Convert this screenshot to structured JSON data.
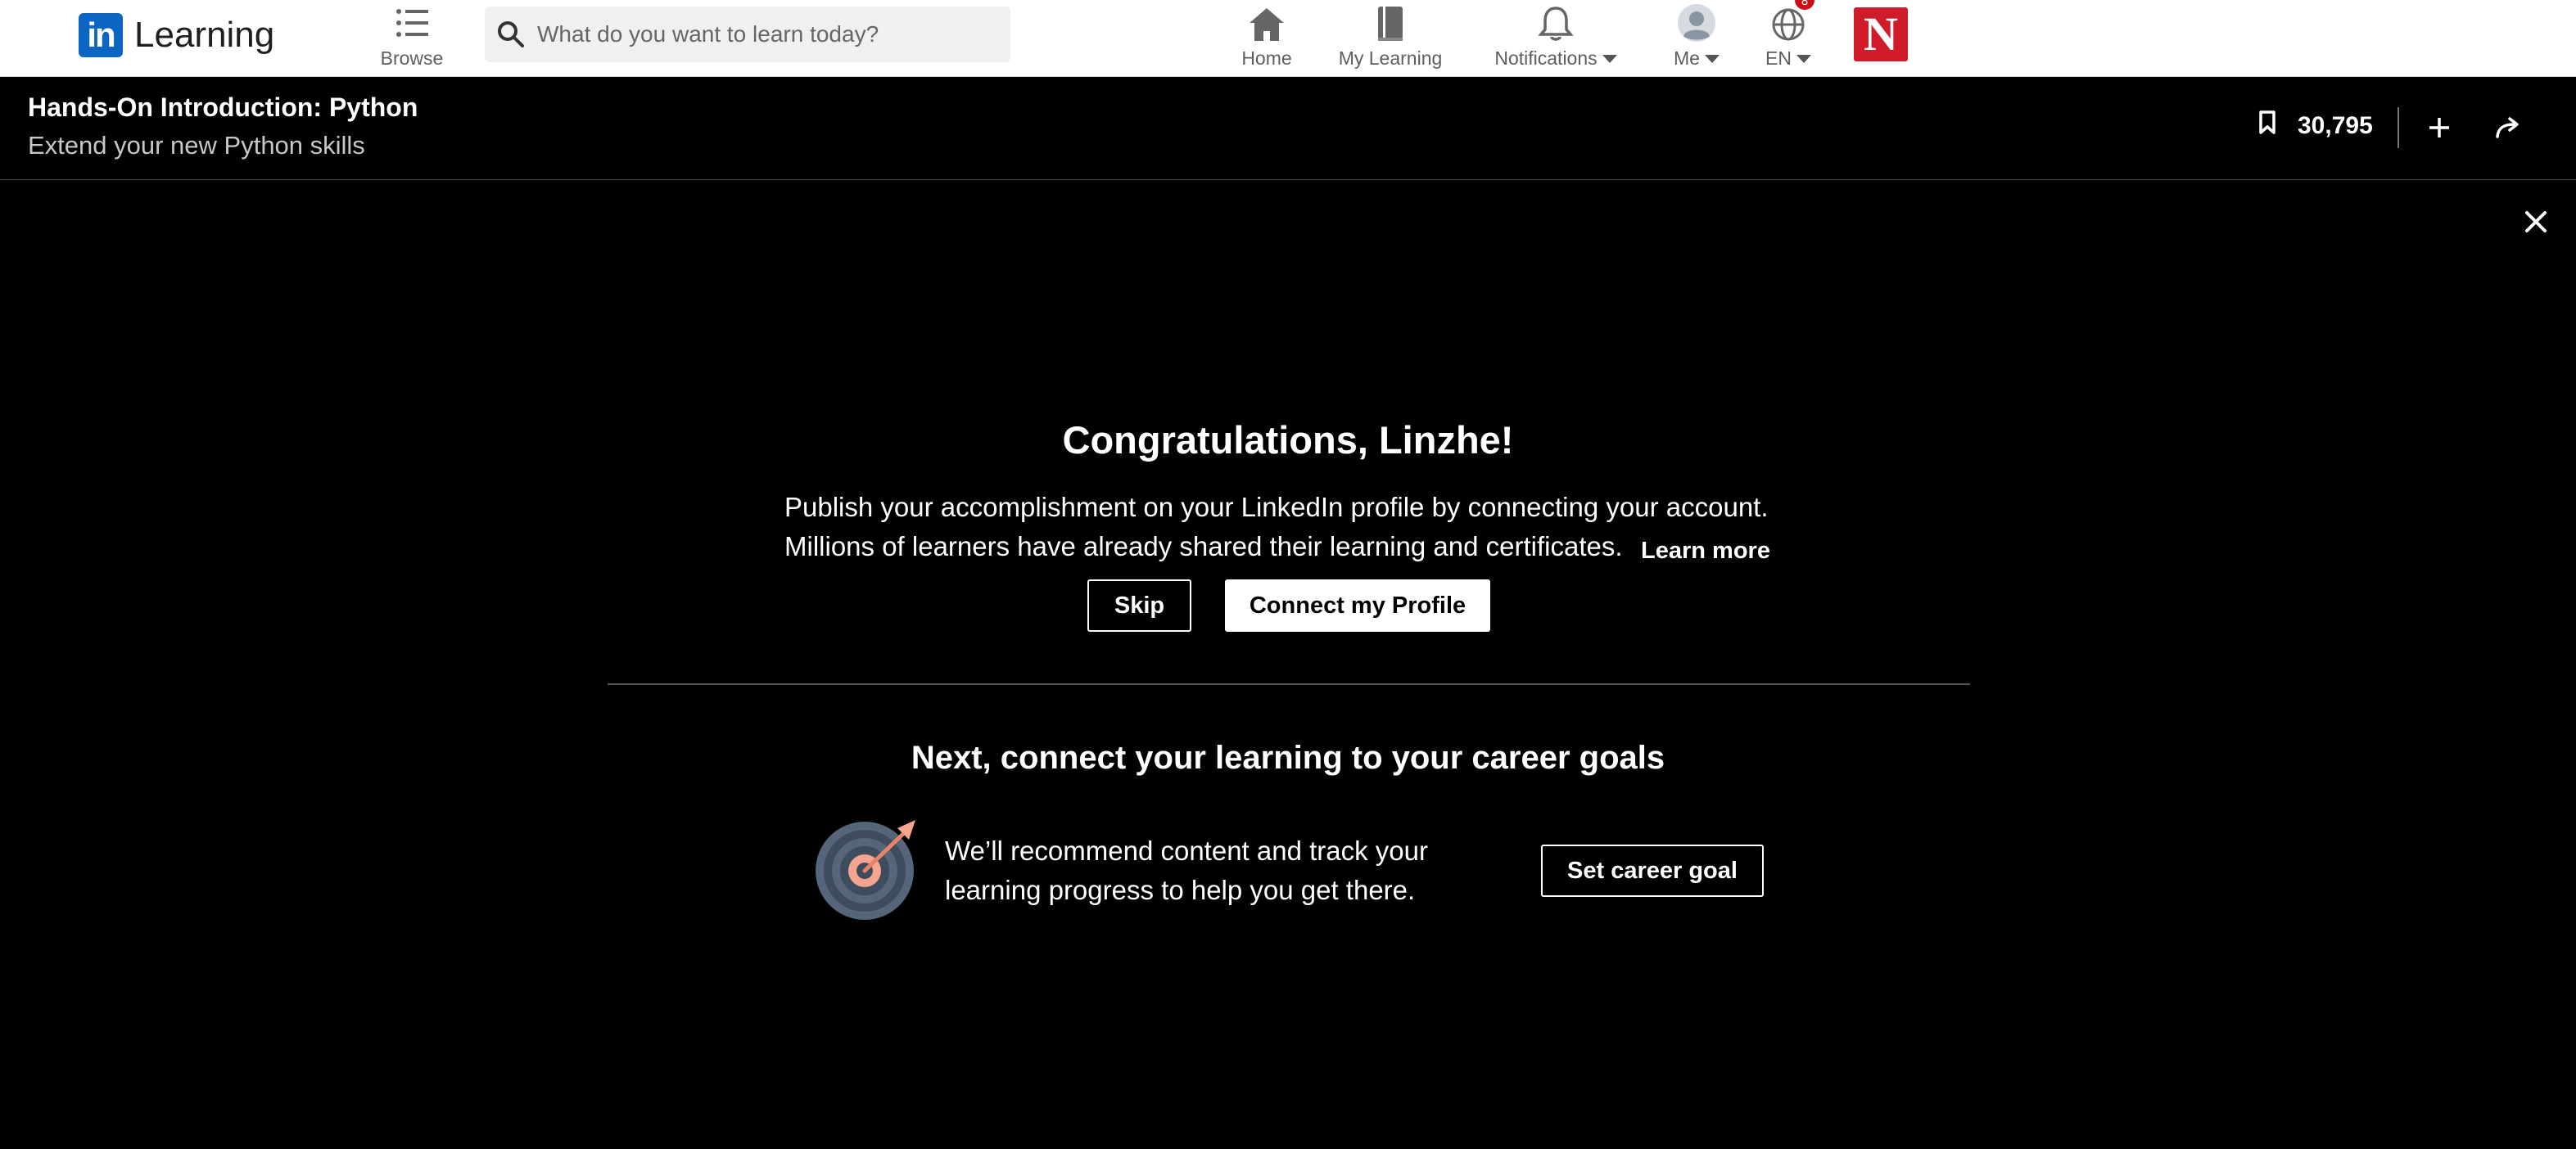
{
  "nav": {
    "logo_mark": "in",
    "logo_text": "Learning",
    "browse_label": "Browse",
    "search_placeholder": "What do you want to learn today?",
    "home_label": "Home",
    "my_learning_label": "My Learning",
    "notifications_label": "Notifications",
    "me_label": "Me",
    "language_label": "EN",
    "language_badge": "8",
    "brand_mark": "N"
  },
  "course": {
    "title": "Hands-On Introduction: Python",
    "subtitle": "Extend your new Python skills",
    "save_count": "30,795"
  },
  "congrats": {
    "heading": "Congratulations, Linzhe!",
    "line1": "Publish your accomplishment on your LinkedIn profile by connecting your account.",
    "line2": "Millions of learners have already shared their learning and certificates.",
    "learn_more": "Learn more",
    "skip_label": "Skip",
    "connect_label": "Connect my Profile"
  },
  "career": {
    "heading": "Next, connect your learning to your career goals",
    "line1": "We’ll recommend content and track your",
    "line2": "learning progress to help you get there.",
    "button_label": "Set career goal"
  },
  "colors": {
    "brand_blue": "#0a66c2",
    "brand_red": "#d01c2a",
    "background": "#000000"
  }
}
